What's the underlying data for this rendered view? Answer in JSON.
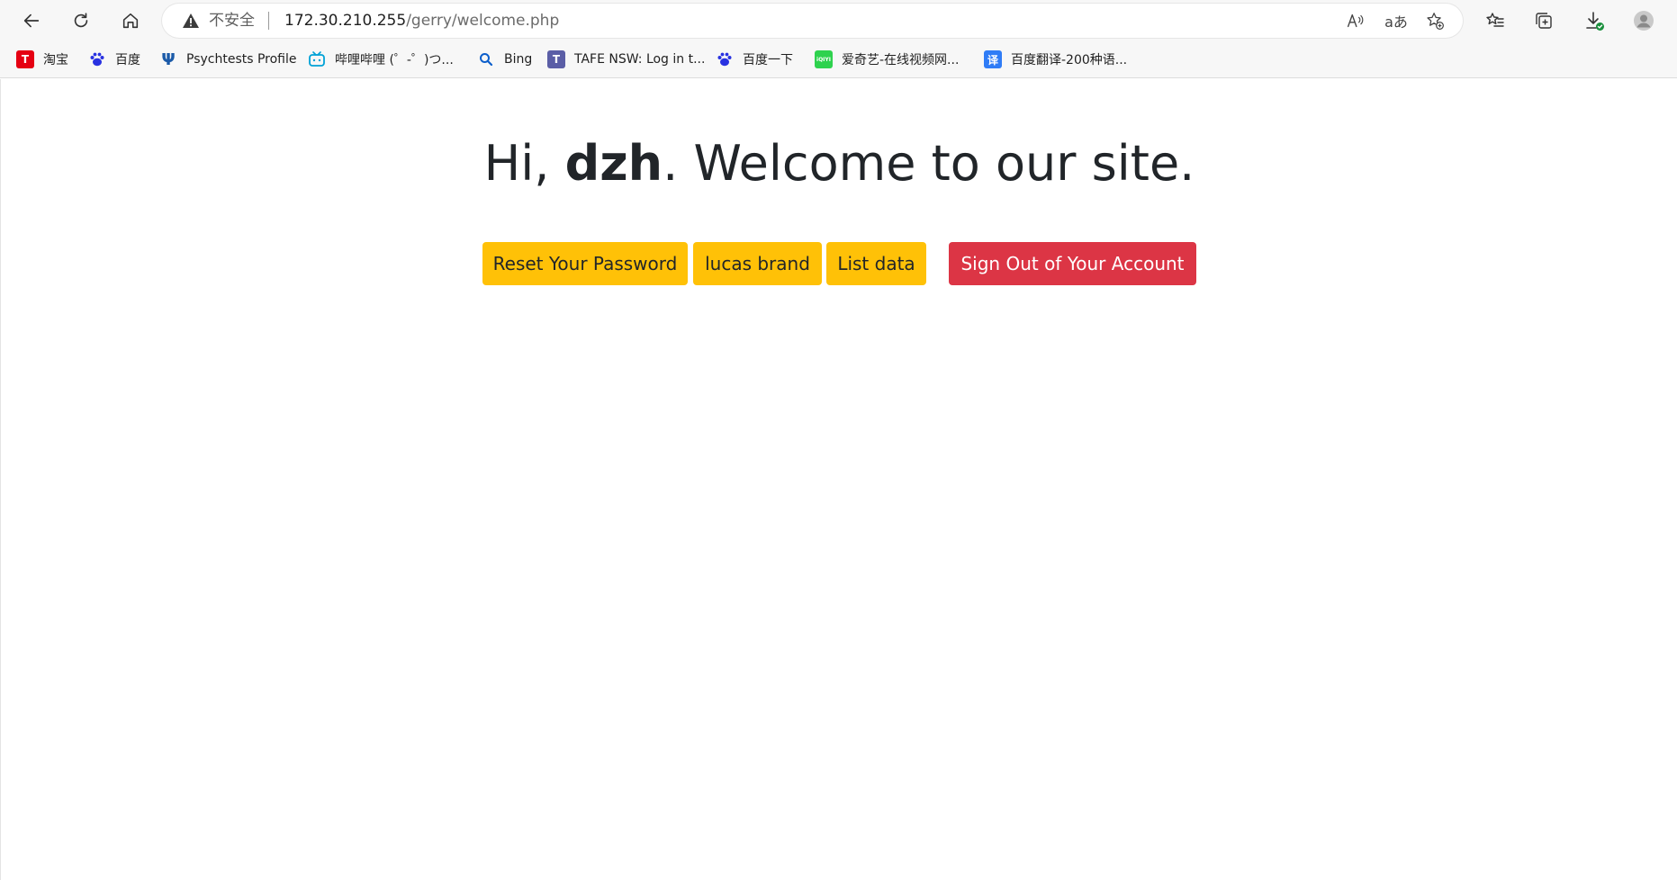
{
  "browser": {
    "address_bar": {
      "security_label": "不安全",
      "url_host": "172.30.210.255",
      "url_path": "/gerry/welcome.php"
    },
    "translate_label": "aあ",
    "bookmarks": [
      {
        "label": "淘宝",
        "icon": "taobao-icon",
        "color": "#e50012",
        "glyph": "T"
      },
      {
        "label": "百度",
        "icon": "baidu-paw-icon",
        "color": "#2932e1",
        "glyph": ""
      },
      {
        "label": "Psychtests Profile",
        "icon": "psychtests-icon",
        "color": "#1b5aa8",
        "glyph": "Ψ"
      },
      {
        "label": "哔哩哔哩 (゜-゜)つ...",
        "icon": "bilibili-icon",
        "color": "#00a1d6",
        "glyph": ""
      },
      {
        "label": "Bing",
        "icon": "bing-search-icon",
        "color": "#0c5ecb",
        "glyph": ""
      },
      {
        "label": "TAFE NSW: Log in t...",
        "icon": "tafe-icon",
        "color": "#5b5ea6",
        "glyph": "T"
      },
      {
        "label": "百度一下",
        "icon": "baidu-paw-icon",
        "color": "#2932e1",
        "glyph": ""
      },
      {
        "label": "爱奇艺-在线视频网...",
        "icon": "iqiyi-icon",
        "color": "#2ed24e",
        "glyph": "iQIYI"
      },
      {
        "label": "百度翻译-200种语...",
        "icon": "baidu-translate-icon",
        "color": "#2f7cf6",
        "glyph": "译"
      }
    ]
  },
  "page": {
    "greeting_prefix": "Hi, ",
    "username": "dzh",
    "greeting_suffix": ". Welcome to our site.",
    "buttons": {
      "reset_password": "Reset Your Password",
      "lucas_brand": "lucas brand",
      "list_data": "List data",
      "sign_out": "Sign Out of Your Account"
    },
    "colors": {
      "warning": "#ffc107",
      "danger": "#dc3545"
    }
  }
}
